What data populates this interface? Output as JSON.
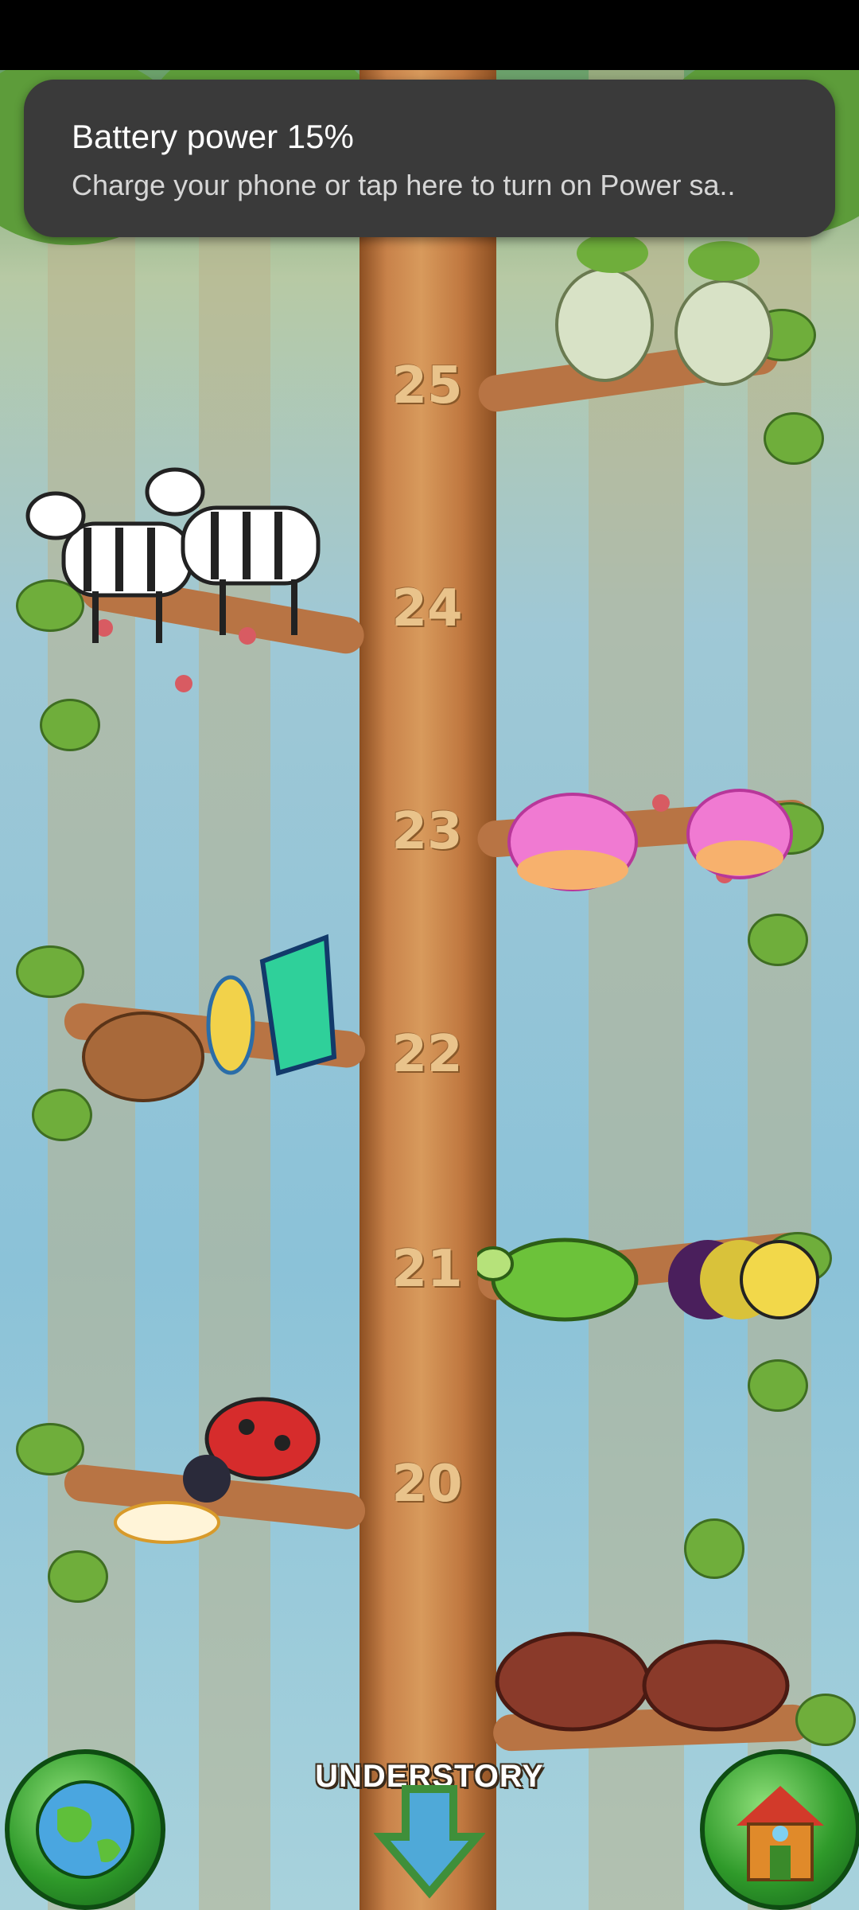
{
  "notification": {
    "title": "Battery power 15%",
    "message": "Charge your phone or tap here to turn on Power sa.."
  },
  "tree": {
    "levels": [
      "25",
      "24",
      "23",
      "22",
      "21",
      "20"
    ],
    "zone_label": "UNDERSTORY"
  },
  "controls": {
    "world_button_icon": "globe-icon",
    "down_button_icon": "down-arrow-icon",
    "home_button_icon": "house-icon"
  },
  "colors": {
    "toast_bg": "#3a3a3a",
    "trunk": "#c8824a",
    "button_green": "#2f9a2a"
  }
}
